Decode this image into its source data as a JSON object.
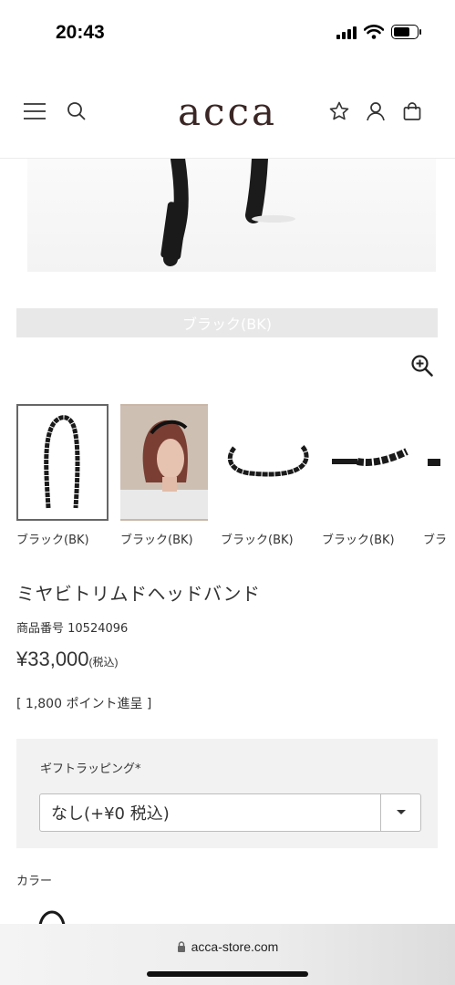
{
  "status_bar": {
    "time": "20:43"
  },
  "header": {
    "logo": "acca"
  },
  "color_bar": {
    "label": "ブラック(BK)"
  },
  "thumbnails": [
    {
      "label": "ブラック(BK)",
      "selected": true
    },
    {
      "label": "ブラック(BK)"
    },
    {
      "label": "ブラック(BK)"
    },
    {
      "label": "ブラック(BK)"
    },
    {
      "label": "ブラ"
    }
  ],
  "product": {
    "name": "ミヤビトリムドヘッドバンド",
    "sku": "商品番号 10524096",
    "price": "¥33,000",
    "price_tax": "(税込)",
    "points": "[ 1,800 ポイント進呈 ]"
  },
  "gift_wrap": {
    "label": "ギフトラッピング",
    "required_mark": "*",
    "selected": "なし(+¥0 税込)"
  },
  "color_section": {
    "heading": "カラー"
  },
  "browser": {
    "url": "acca-store.com"
  }
}
